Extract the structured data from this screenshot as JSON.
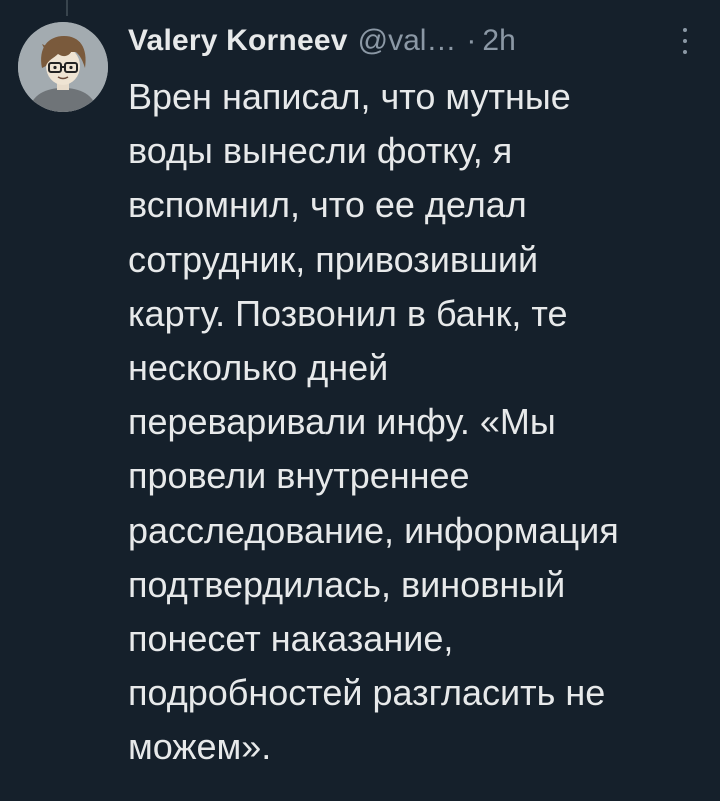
{
  "tweet": {
    "display_name": "Valery Korneev",
    "handle": "@val…",
    "separator": "·",
    "time": "2h",
    "more_icon": "more-vertical-icon",
    "avatar_icon": "avatar-illustration",
    "text_lines": [
      "Врен написал, что мутные",
      "воды вынесли фотку, я",
      "вспомнил, что ее делал",
      "сотрудник, привозивший",
      "карту. Позвонил в банк, те",
      "несколько дней",
      "переваривали инфу. «Мы",
      "провели внутреннее",
      "расследование, информация",
      "подтвердилась, виновный",
      "понесет наказание,",
      "подробностей разгласить не",
      "можем»."
    ]
  },
  "colors": {
    "background": "#15202b",
    "primary_text": "#e7e9ea",
    "secondary_text": "#8b98a5",
    "thread_line": "#38444d"
  }
}
